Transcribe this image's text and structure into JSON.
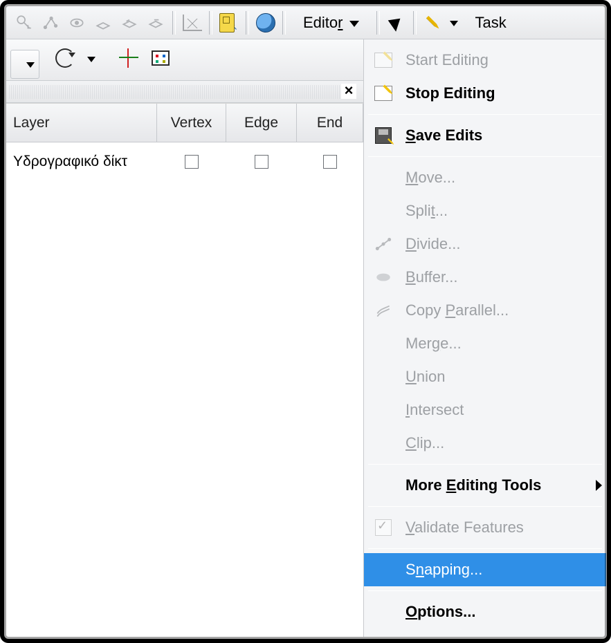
{
  "toolbar": {
    "editor_label_pre": "Edito",
    "editor_label_ul": "r",
    "task_label": "Task"
  },
  "snapping_table": {
    "columns": {
      "layer": "Layer",
      "vertex": "Vertex",
      "edge": "Edge",
      "end": "End"
    },
    "rows": [
      {
        "layer": "Υδρογραφικό δίκτ",
        "vertex": false,
        "edge": false,
        "end": false
      }
    ]
  },
  "editor_menu": {
    "start_editing": "Start Editing",
    "stop_editing": "Stop Editing",
    "save_edits_pre": "",
    "save_edits_ul": "S",
    "save_edits_post": "ave Edits",
    "move_ul": "M",
    "move_post": "ove...",
    "split_pre": "Spli",
    "split_ul": "t",
    "split_post": "...",
    "divide_ul": "D",
    "divide_post": "ivide...",
    "buffer_ul": "B",
    "buffer_post": "uffer...",
    "copy_par_pre": "Copy ",
    "copy_par_ul": "P",
    "copy_par_post": "arallel...",
    "merge_pre": "Mer",
    "merge_ul": "g",
    "merge_post": "e...",
    "union_ul": "U",
    "union_post": "nion",
    "intersect_ul": "I",
    "intersect_post": "ntersect",
    "clip_ul": "C",
    "clip_post": "lip...",
    "more_tools_pre": "More ",
    "more_tools_ul": "E",
    "more_tools_post": "diting Tools",
    "validate_ul": "V",
    "validate_post": "alidate Features",
    "snapping_pre": "S",
    "snapping_ul": "n",
    "snapping_post": "apping...",
    "options_ul": "O",
    "options_post": "ptions..."
  }
}
